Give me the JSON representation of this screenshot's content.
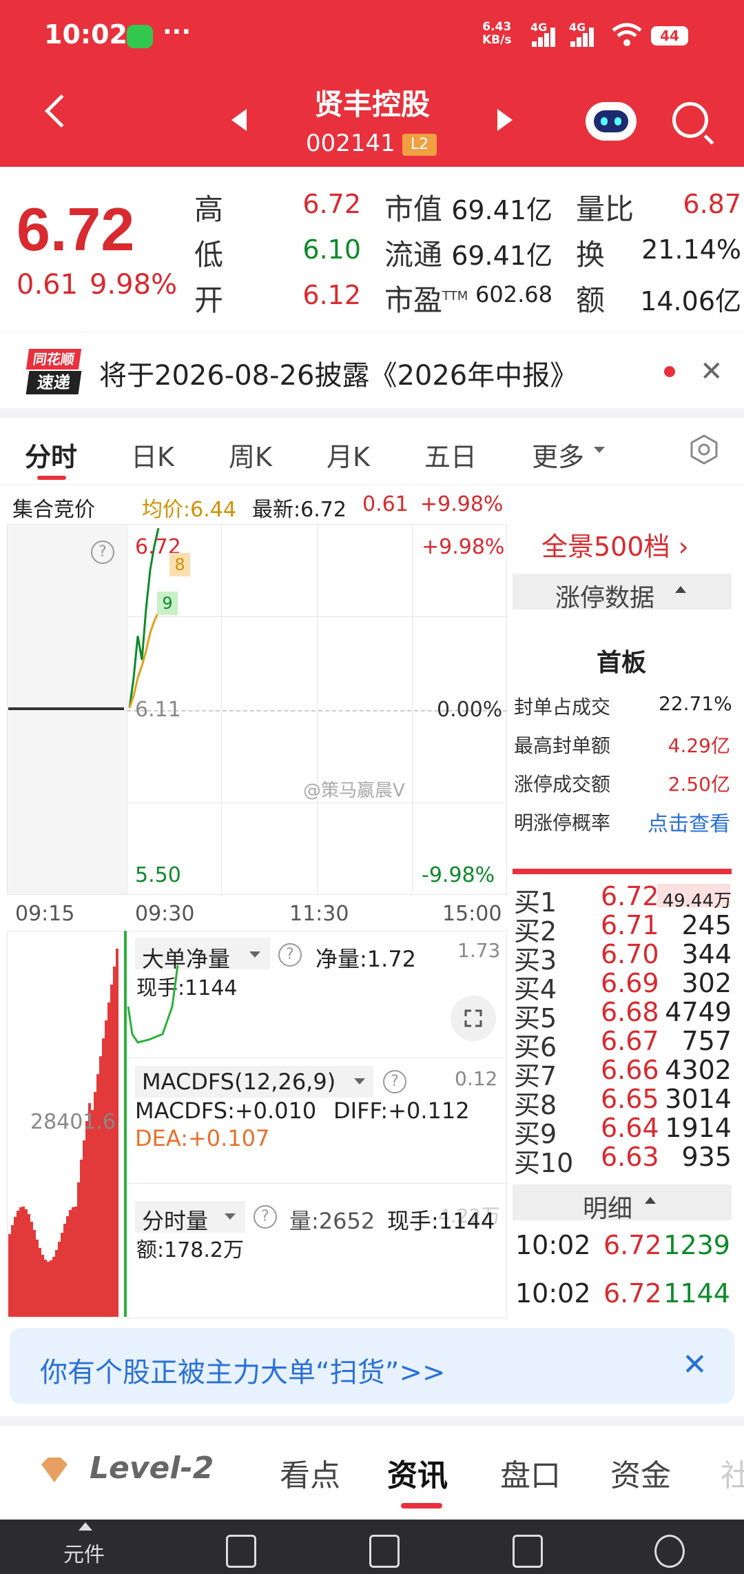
{
  "status_bar": {
    "time": "10:02",
    "net_speed": "6.43",
    "net_unit": "KB/s",
    "net1": "4G",
    "net2": "4G",
    "battery": "44",
    "more": "···"
  },
  "header": {
    "stock_name": "贤丰控股",
    "stock_code": "002141",
    "level_badge": "L2"
  },
  "quote": {
    "price": "6.72",
    "change": "0.61",
    "change_pct": "9.98%",
    "high_label": "高",
    "high": "6.72",
    "low_label": "低",
    "low": "6.10",
    "open_label": "开",
    "open": "6.12",
    "mcap_label": "市值",
    "mcap": "69.41亿",
    "float_label": "流通",
    "float": "69.41亿",
    "pe_label": "市盈",
    "pe_suffix": "TTM",
    "pe": "602.68",
    "vr_label": "量比",
    "vr": "6.87",
    "turn_label": "换",
    "turn": "21.14%",
    "amt_label": "额",
    "amt": "14.06亿"
  },
  "notice": {
    "logo_top": "同花顺",
    "logo_bottom": "速递",
    "text": "将于2026-08-26披露《2026年中报》"
  },
  "tabs": [
    "分时",
    "日K",
    "周K",
    "月K",
    "五日",
    "更多"
  ],
  "chart_header": {
    "auction": "集合竞价",
    "avg": "均价:6.44",
    "latest": "最新:6.72",
    "chg": "0.61",
    "pct": "+9.98%"
  },
  "chart": {
    "y_top": "6.72",
    "y_mid": "6.11",
    "y_bot": "5.50",
    "pct_top": "+9.98%",
    "pct_mid": "0.00%",
    "pct_bot": "-9.98%",
    "x_labels": [
      "09:15",
      "09:30",
      "11:30",
      "15:00"
    ],
    "badge_8": "8",
    "badge_9": "9",
    "watermark": "@策马嬴晨V"
  },
  "chart_data": {
    "type": "line",
    "x": [
      "09:30",
      "09:35",
      "09:40",
      "09:45",
      "09:50",
      "09:55",
      "10:00",
      "10:02"
    ],
    "series": [
      {
        "name": "最新",
        "values": [
          6.12,
          6.22,
          6.36,
          6.28,
          6.45,
          6.58,
          6.66,
          6.72
        ]
      },
      {
        "name": "均价",
        "values": [
          6.12,
          6.16,
          6.22,
          6.26,
          6.31,
          6.37,
          6.41,
          6.44
        ]
      }
    ],
    "ylim": [
      5.5,
      6.72
    ]
  },
  "side": {
    "panorama": "全景500档",
    "limit_data": "涨停数据",
    "board": "首板",
    "rows": [
      {
        "label": "封单占成交",
        "value": "22.71%"
      },
      {
        "label": "最高封单额",
        "value": "4.29亿"
      },
      {
        "label": "涨停成交额",
        "value": "2.50亿"
      },
      {
        "label": "明涨停概率",
        "value": "点击查看"
      }
    ]
  },
  "orderbook": [
    {
      "label": "买1",
      "price": "6.72",
      "vol": "49.44万"
    },
    {
      "label": "买2",
      "price": "6.71",
      "vol": "245"
    },
    {
      "label": "买3",
      "price": "6.70",
      "vol": "344"
    },
    {
      "label": "买4",
      "price": "6.69",
      "vol": "302"
    },
    {
      "label": "买5",
      "price": "6.68",
      "vol": "4749"
    },
    {
      "label": "买6",
      "price": "6.67",
      "vol": "757"
    },
    {
      "label": "买7",
      "price": "6.66",
      "vol": "4302"
    },
    {
      "label": "买8",
      "price": "6.65",
      "vol": "3014"
    },
    {
      "label": "买9",
      "price": "6.64",
      "vol": "1914"
    },
    {
      "label": "买10",
      "price": "6.63",
      "vol": "935"
    }
  ],
  "detail": {
    "title": "明细",
    "rows": [
      {
        "time": "10:02",
        "price": "6.72",
        "vol": "1239"
      },
      {
        "time": "10:02",
        "price": "6.72",
        "vol": "1144"
      }
    ]
  },
  "panels": {
    "big_order": "大单净量",
    "net_label": "净量:1.72",
    "net_right": "1.73",
    "hand": "现手:1144",
    "macd": "MACDFS(12,26,9)",
    "macd_right": "0.12",
    "macdfs": "MACDFS:+0.010",
    "diff": "DIFF:+0.112",
    "dea": "DEA:+0.107",
    "left_value": "28401.6",
    "volume": "分时量",
    "vol_val": "量:2652",
    "vol_hand": "现手:1144",
    "vol_amt": "额:178.2万",
    "vol_right": "4.22万"
  },
  "banner": {
    "text": "你有个股正被主力大单“扫货”>>"
  },
  "bottom_tabs": [
    "Level-2",
    "看点",
    "资讯",
    "盘口",
    "资金",
    "社"
  ],
  "dock": {
    "first": "元件"
  }
}
